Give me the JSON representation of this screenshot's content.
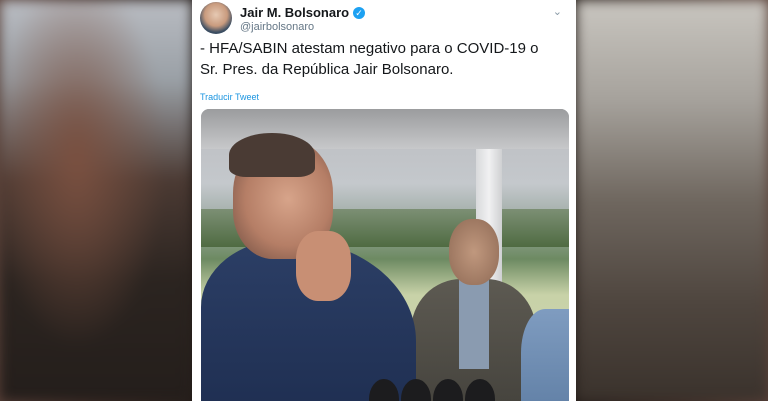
{
  "tweet": {
    "display_name": "Jair M. Bolsonaro",
    "handle": "@jairbolsonaro",
    "verified_glyph": "✓",
    "menu_glyph": "⌄",
    "text": "- HFA/SABIN atestam negativo para o COVID-19 o Sr. Pres. da República Jair Bolsonaro.",
    "translate_label": "Traducir Tweet"
  },
  "colors": {
    "link": "#1b95e0",
    "verified": "#1da1f2",
    "text": "#14171a",
    "secondary": "#657786"
  },
  "icons": [
    "verified-badge-icon",
    "chevron-down-icon"
  ]
}
